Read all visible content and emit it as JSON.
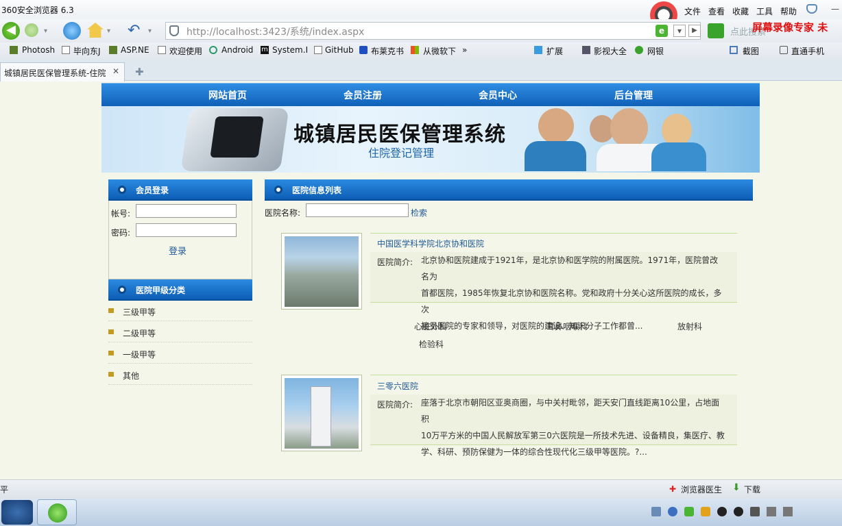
{
  "browser": {
    "title": "360安全浏览器 6.3",
    "menu": [
      "文件",
      "查看",
      "收藏",
      "工具",
      "帮助"
    ],
    "address": "http://localhost:3423/系统/index.aspx",
    "search_placeholder": "点此搜索",
    "watermark": "屏幕录像专家 未",
    "bookmarks": [
      "Photosh",
      "毕向东J",
      "ASP.NE",
      "欢迎使用",
      "Android",
      "System.I",
      "GitHub",
      "布莱克书",
      "从微软下"
    ],
    "bookmarks_more": "»",
    "right_tools": [
      "扩展",
      "影视大全",
      "网银",
      "截图",
      "直通手机"
    ],
    "tab_title": "城镇居民医保管理系统-住院",
    "tab_close": "✕",
    "new_tab": "✚",
    "status_left": "平",
    "status_right": [
      "浏览器医生",
      "下载"
    ]
  },
  "site": {
    "nav": [
      "网站首页",
      "会员注册",
      "会员中心",
      "后台管理"
    ],
    "banner_title": "城镇居民医保管理系统",
    "banner_subtitle": "住院登记管理",
    "login": {
      "title": "会员登录",
      "account_label": "帐号:",
      "password_label": "密码:",
      "button": "登录"
    },
    "categories": {
      "title": "医院甲级分类",
      "items": [
        "三级甲等",
        "二级甲等",
        "一级甲等",
        "其他"
      ]
    },
    "list": {
      "title": "医院信息列表",
      "search_label": "医院名称:",
      "search_button": "检索"
    },
    "hospitals": [
      {
        "name": "中国医学科学院北京协和医院",
        "desc_label": "医院简介:",
        "desc_lines": [
          "北京协和医院建成于1921年，是北京协和医学院的附属医院。1971年，医院曾改名为",
          "首都医院，1985年恢复北京协和医院名称。党和政府十分关心这所医院的成长，多次",
          "接见医院的专家和领导，对医院的建设、知识分子工作都曾..."
        ],
        "depts": [
          "心脏外科",
          "耳鼻咽喉科",
          "放射科",
          "检验科"
        ]
      },
      {
        "name": "三零六医院",
        "desc_label": "医院简介:",
        "desc_lines": [
          "座落于北京市朝阳区亚奥商圈，与中关村毗邻，距天安门直线距离10公里，占地面积",
          "10万平方米的中国人民解放军第三0六医院是一所技术先进、设备精良，集医疗、教",
          "学、科研、预防保健为一体的综合性现代化三级甲等医院。?..."
        ]
      }
    ]
  }
}
